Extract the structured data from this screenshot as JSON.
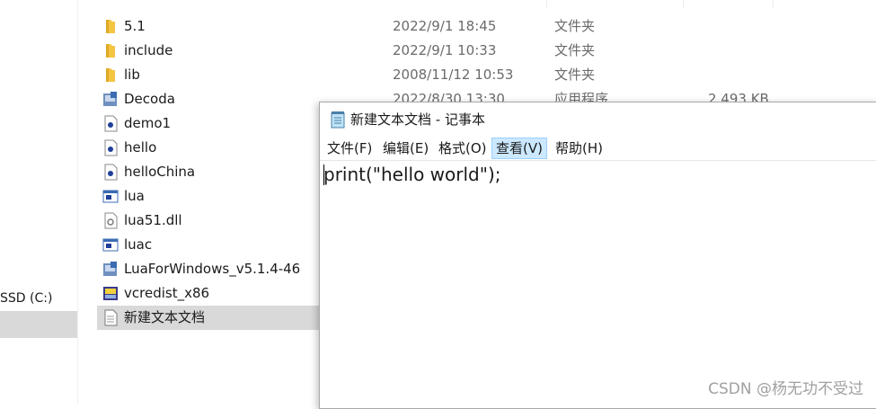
{
  "explorer": {
    "nav_drive_label": "SSD (C:)",
    "files": [
      {
        "name": "5.1",
        "date": "2022/9/1 18:45",
        "type": "文件夹",
        "size": "",
        "icon": "folder-icon"
      },
      {
        "name": "include",
        "date": "2022/9/1 10:33",
        "type": "文件夹",
        "size": "",
        "icon": "folder-icon"
      },
      {
        "name": "lib",
        "date": "2008/11/12 10:53",
        "type": "文件夹",
        "size": "",
        "icon": "folder-icon"
      },
      {
        "name": "Decoda",
        "date": "2022/8/30 13:30",
        "type": "应用程序",
        "size": "2,493 KB",
        "icon": "installer-icon"
      },
      {
        "name": "demo1",
        "date": "",
        "type": "",
        "size": "",
        "icon": "lua-file-icon"
      },
      {
        "name": "hello",
        "date": "",
        "type": "",
        "size": "",
        "icon": "lua-file-icon"
      },
      {
        "name": "helloChina",
        "date": "",
        "type": "",
        "size": "",
        "icon": "lua-file-icon"
      },
      {
        "name": "lua",
        "date": "",
        "type": "",
        "size": "",
        "icon": "console-app-icon"
      },
      {
        "name": "lua51.dll",
        "date": "",
        "type": "",
        "size": "",
        "icon": "dll-file-icon"
      },
      {
        "name": "luac",
        "date": "",
        "type": "",
        "size": "",
        "icon": "console-app-icon"
      },
      {
        "name": "LuaForWindows_v5.1.4-46",
        "date": "",
        "type": "",
        "size": "",
        "icon": "installer-icon"
      },
      {
        "name": "vcredist_x86",
        "date": "",
        "type": "",
        "size": "",
        "icon": "setup-icon"
      },
      {
        "name": "新建文本文档",
        "date": "",
        "type": "",
        "size": "",
        "icon": "text-file-icon"
      }
    ]
  },
  "notepad": {
    "title": "新建文本文档 - 记事本",
    "menu": [
      "文件(F)",
      "编辑(E)",
      "格式(O)",
      "查看(V)",
      "帮助(H)"
    ],
    "content": "print(\"hello world\");"
  },
  "watermark": "CSDN @杨无功不受过",
  "colors": {
    "selection": "#d9d9d9",
    "menu_hover": "#cce8ff",
    "folder": "#f4c542"
  }
}
